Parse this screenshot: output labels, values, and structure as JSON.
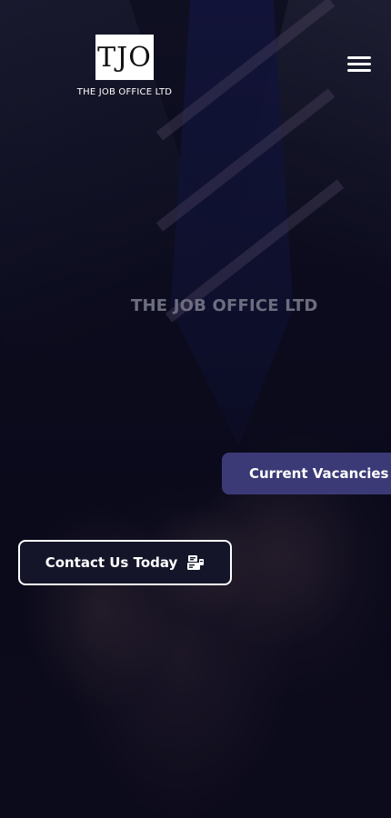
{
  "header": {
    "logo_mark": "TJO",
    "logo_name": "THE JOB OFFICE LTD",
    "menu_icon": "hamburger-menu-icon"
  },
  "hero": {
    "headline": "THE JOB OFFICE LTD",
    "vacancies_label": "Current Vacancies",
    "contact_label": "Contact Us Today",
    "contact_icon": "contact-card-icon"
  },
  "colors": {
    "background": "#0b0b1c",
    "accent_button": "#3b3a77",
    "headline_text": "#6d6d80",
    "white": "#ffffff"
  }
}
